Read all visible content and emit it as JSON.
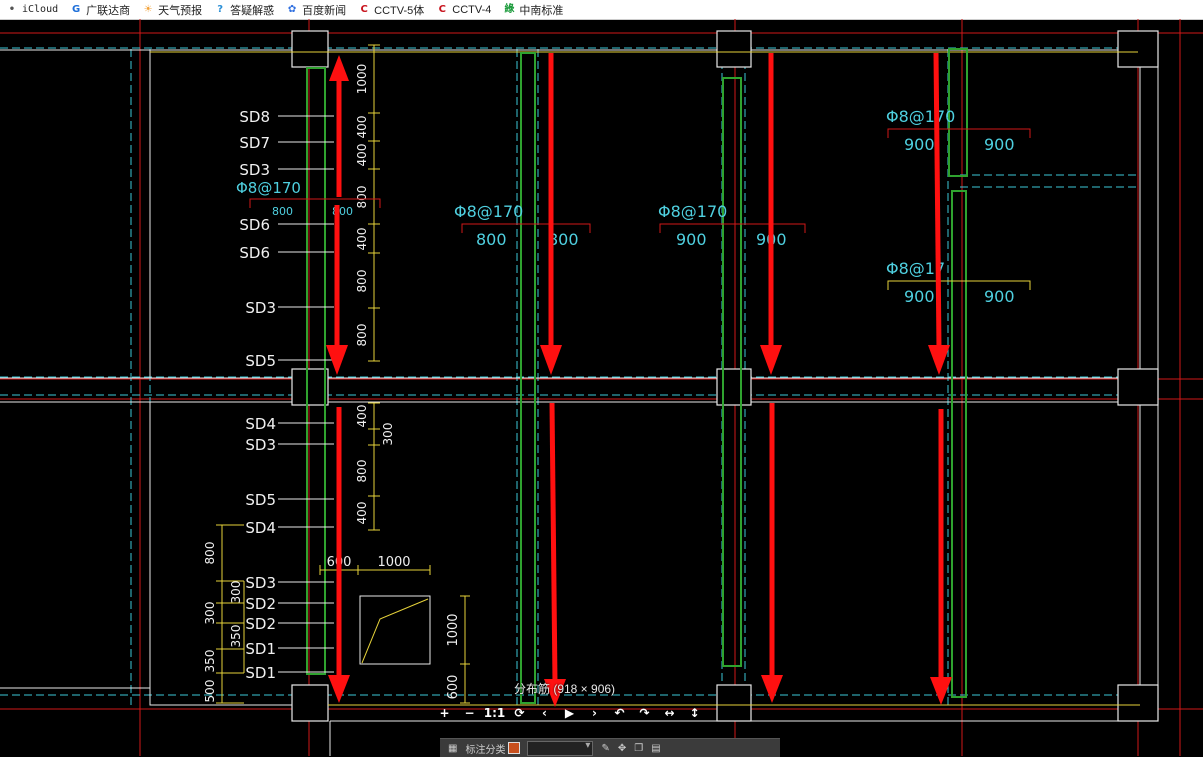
{
  "bookmarks": [
    {
      "label": "iCloud",
      "icon": "apple-icon",
      "color": "#555555"
    },
    {
      "label": "广联达商",
      "icon": "glodon-icon",
      "color": "#1e6fd9"
    },
    {
      "label": "天气预报",
      "icon": "weather-icon",
      "color": "#f2a23a"
    },
    {
      "label": "答疑解惑",
      "icon": "qa-icon",
      "color": "#2a8fd6"
    },
    {
      "label": "百度新闻",
      "icon": "baidu-paw-icon",
      "color": "#2f6fe0"
    },
    {
      "label": "CCTV-5体",
      "icon": "cctv-icon",
      "color": "#c8141e"
    },
    {
      "label": "CCTV-4",
      "icon": "cctv-icon",
      "color": "#c8141e"
    },
    {
      "label": "中南标准",
      "icon": "zhongnan-icon",
      "color": "#1a9a3a"
    }
  ],
  "drawing": {
    "colors": {
      "background": "#000000",
      "axis_red": "#d01818",
      "dash_cyan": "#3cc8d8",
      "wall_white": "#e8e8e8",
      "rebar_green": "#2fa32f",
      "dim_yellow": "#e6d23a",
      "label_white": "#f0f0f0",
      "label_cyan": "#4fd0e0",
      "annotation_red": "#ff1010"
    },
    "section_labels_upper": [
      "SD8",
      "SD7",
      "SD3",
      "SD6",
      "SD6",
      "SD3",
      "SD5"
    ],
    "section_labels_lower": [
      "SD4",
      "SD3",
      "SD5",
      "SD4",
      "SD3",
      "SD2",
      "SD2",
      "SD1",
      "SD1"
    ],
    "dims_vertical_upper": [
      "1000",
      "400",
      "400",
      "800",
      "400",
      "800",
      "800"
    ],
    "dims_vertical_lower": [
      "400",
      "300",
      "800",
      "400"
    ],
    "dims_left_stack": [
      "800",
      "300",
      "300",
      "350",
      "350",
      "500"
    ],
    "dims_left_stack_inner": [
      "300",
      "350"
    ],
    "detail_dims": {
      "top_a": "600",
      "top_b": "1000",
      "right_a": "1000",
      "right_b": "600"
    },
    "rebar_notes": [
      {
        "text": "Φ8@170",
        "left": "800",
        "right": "800"
      },
      {
        "text": "Φ8@170",
        "left": "800",
        "right": "800"
      },
      {
        "text": "Φ8@170",
        "left": "900",
        "right": "900"
      },
      {
        "text": "Φ8@170",
        "left": "900",
        "right": "900"
      },
      {
        "text": "Φ8@17",
        "left": "900",
        "right": "900"
      }
    ]
  },
  "viewer": {
    "caption": "分布筋 (918 × 906)",
    "toolbar": [
      "+",
      "−",
      "1:1",
      "⟳",
      "‹",
      "▶",
      "›",
      "↶",
      "↷",
      "↔",
      "↕"
    ]
  },
  "bottom_bar": {
    "label": "标注分类"
  }
}
